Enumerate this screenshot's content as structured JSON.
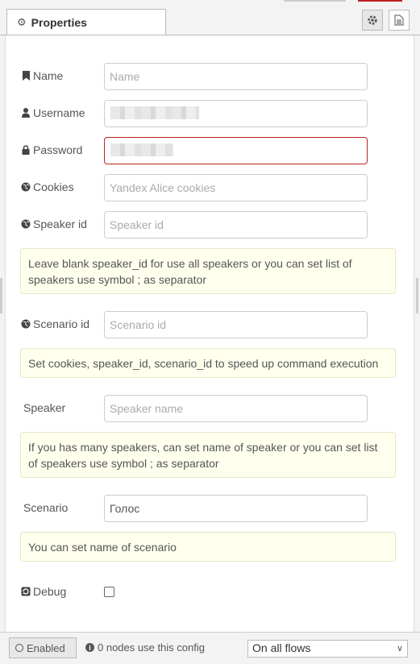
{
  "tabs": {
    "properties_label": "Properties"
  },
  "form": {
    "name": {
      "label": "Name",
      "placeholder": "Name",
      "value": ""
    },
    "username": {
      "label": "Username"
    },
    "password": {
      "label": "Password"
    },
    "cookies": {
      "label": "Cookies",
      "placeholder": "Yandex Alice cookies",
      "value": ""
    },
    "speaker_id": {
      "label": "Speaker id",
      "placeholder": "Speaker id",
      "value": ""
    },
    "speaker_id_tip": "Leave blank speaker_id for use all speakers or you can set list of speakers use symbol ; as separator",
    "scenario_id": {
      "label": "Scenario id",
      "placeholder": "Scenario id",
      "value": ""
    },
    "scenario_id_tip": "Set cookies, speaker_id, scenario_id to speed up command execution",
    "speaker": {
      "label": "Speaker",
      "placeholder": "Speaker name",
      "value": ""
    },
    "speaker_tip": "If you has many speakers, can set name of speaker or you can set list of speakers use symbol ; as separator",
    "scenario": {
      "label": "Scenario",
      "value": "Голос"
    },
    "scenario_tip": "You can set name of scenario",
    "debug": {
      "label": "Debug",
      "checked": false
    }
  },
  "footer": {
    "enabled_label": "Enabled",
    "usage_text": "0 nodes use this config",
    "scope_selected": "On all flows"
  },
  "colors": {
    "invalid_border": "#c02020",
    "tip_bg": "#ffffee"
  }
}
